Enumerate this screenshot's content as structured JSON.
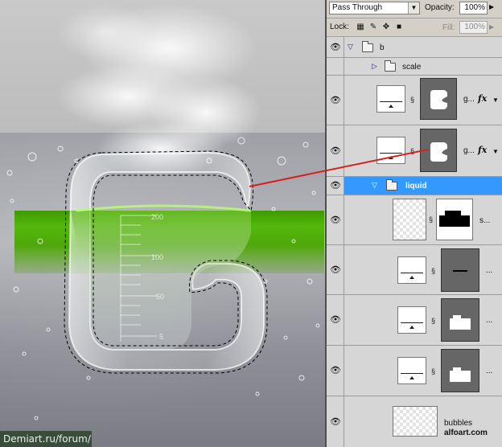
{
  "layers_panel": {
    "blend_mode": "Pass Through",
    "opacity_label": "Opacity:",
    "opacity_value": "100%",
    "lock_label": "Lock:",
    "fill_label": "Fill:",
    "fill_value": "100%",
    "layers": [
      {
        "name": "b",
        "type": "group",
        "expanded": true,
        "visible": true
      },
      {
        "name": "scale",
        "type": "group",
        "expanded": false,
        "visible": false
      },
      {
        "name": "g...",
        "type": "layer-with-mask",
        "fx": "fx",
        "visible": true
      },
      {
        "name": "g...",
        "type": "layer-with-mask",
        "fx": "fx",
        "visible": true
      },
      {
        "name": "liquid",
        "type": "group",
        "expanded": true,
        "visible": true,
        "selected": true
      },
      {
        "name": "s...",
        "type": "layer-with-mask",
        "visible": true
      },
      {
        "name": "...",
        "type": "layer-with-mask",
        "visible": true
      },
      {
        "name": "...",
        "type": "layer-with-mask",
        "visible": true
      },
      {
        "name": "...",
        "type": "layer-with-mask",
        "visible": true
      },
      {
        "name": "bubbles",
        "type": "layer",
        "visible": true
      }
    ]
  },
  "canvas": {
    "scale_marks": [
      "200",
      "100",
      "50",
      "5"
    ],
    "watermark": "Demiart.ru/forum/",
    "site_credit": "alfoart.com"
  },
  "colors": {
    "selection": "#3399ff",
    "liquid_green": "#4fa80a",
    "annotation_line": "#d62020"
  }
}
